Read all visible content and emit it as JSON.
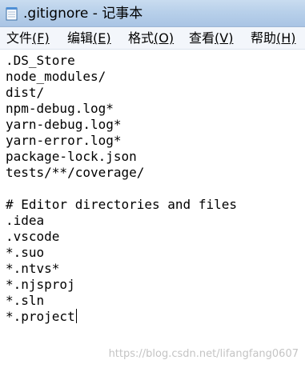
{
  "window": {
    "title": ".gitignore - 记事本",
    "icon": "notepad-icon",
    "titlebar_color": "#b8d0ea"
  },
  "menu": [
    {
      "label": "文件",
      "accel": "(F)"
    },
    {
      "label": "编辑",
      "accel": "(E)"
    },
    {
      "label": "格式",
      "accel": "(O)"
    },
    {
      "label": "查看",
      "accel": "(V)"
    },
    {
      "label": "帮助",
      "accel": "(H)"
    }
  ],
  "editor": {
    "lines": [
      ".DS_Store",
      "node_modules/",
      "dist/",
      "npm-debug.log*",
      "yarn-debug.log*",
      "yarn-error.log*",
      "package-lock.json",
      "tests/**/coverage/",
      "",
      "# Editor directories and files",
      ".idea",
      ".vscode",
      "*.suo",
      "*.ntvs*",
      "*.njsproj",
      "*.sln",
      "*.project"
    ]
  },
  "watermark": "https://blog.csdn.net/lifangfang0607"
}
